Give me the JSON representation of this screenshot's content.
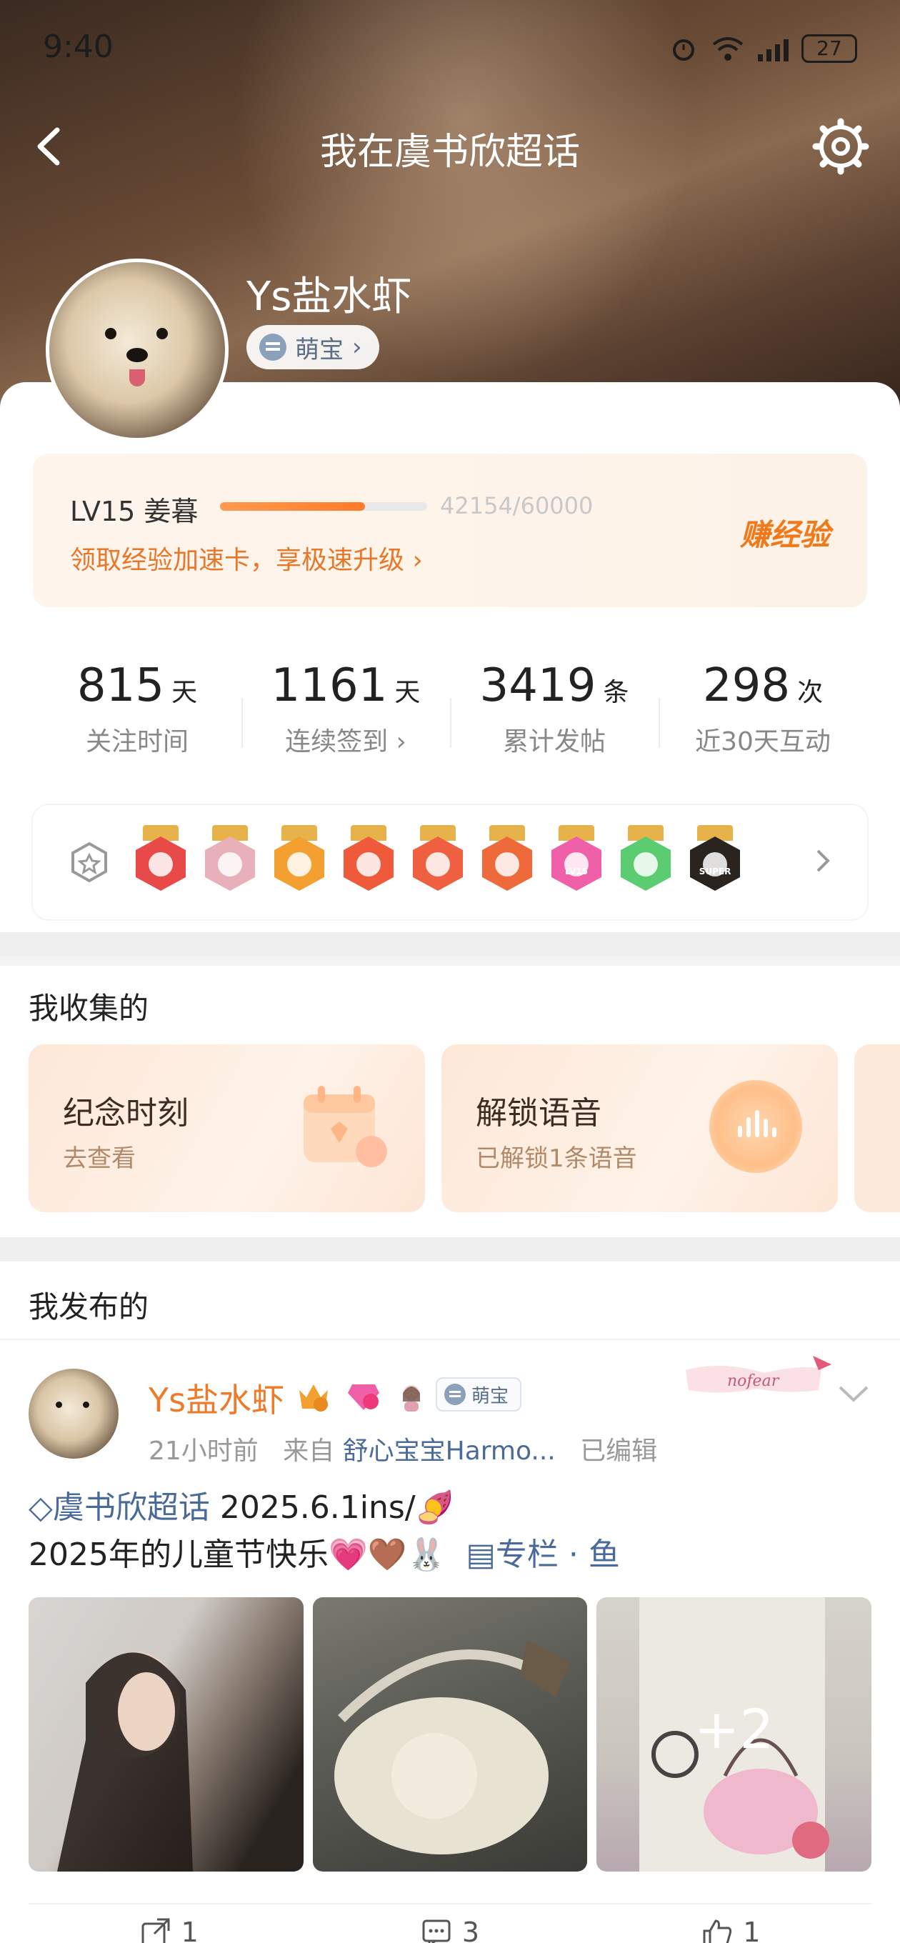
{
  "status_bar": {
    "time": "9:40",
    "battery": "27"
  },
  "nav": {
    "title": "我在虞书欣超话"
  },
  "profile": {
    "username": "Ys盐水虾",
    "tag": "萌宝"
  },
  "level": {
    "name": "LV15 姜暮",
    "progress": 0.7,
    "exp": "42154/60000",
    "promo": "领取经验加速卡，享极速升级",
    "earn": "赚经验"
  },
  "stats": [
    {
      "value": "815",
      "unit": "天",
      "label": "关注时间"
    },
    {
      "value": "1161",
      "unit": "天",
      "label": "连续签到 ›"
    },
    {
      "value": "3419",
      "unit": "条",
      "label": "累计发帖"
    },
    {
      "value": "298",
      "unit": "次",
      "label": "近30天互动"
    }
  ],
  "badges": {
    "colors": [
      "#e84a4a",
      "#e8b0b8",
      "#f4a030",
      "#ee5a3a",
      "#ee6040",
      "#ee6a3a",
      "#f060a8",
      "#5ccc70",
      "#2a2420"
    ],
    "labels": [
      "",
      "",
      "",
      "",
      "",
      "",
      "LV15",
      "",
      "SUPER"
    ]
  },
  "collect": {
    "title": "我收集的",
    "cards": [
      {
        "title": "纪念时刻",
        "sub": "去查看"
      },
      {
        "title": "解锁语音",
        "sub": "已解锁1条语音"
      }
    ]
  },
  "posted": {
    "title": "我发布的"
  },
  "post": {
    "author": "Ys盐水虾",
    "tag": "萌宝",
    "sticker": "nofear",
    "time": "21小时前",
    "from_prefix": "来自",
    "source": "舒心宝宝Harmo...",
    "edited": "已编辑",
    "topic": "虞书欣超话",
    "line1": " 2025.6.1ins/🍠",
    "line2": "2025年的儿童节快乐💗🤎🐰",
    "column": "专栏",
    "dot": "·",
    "column_name": "鱼",
    "more_photos": "+2",
    "actions": {
      "share": "1",
      "comment": "3",
      "like": "1"
    }
  }
}
